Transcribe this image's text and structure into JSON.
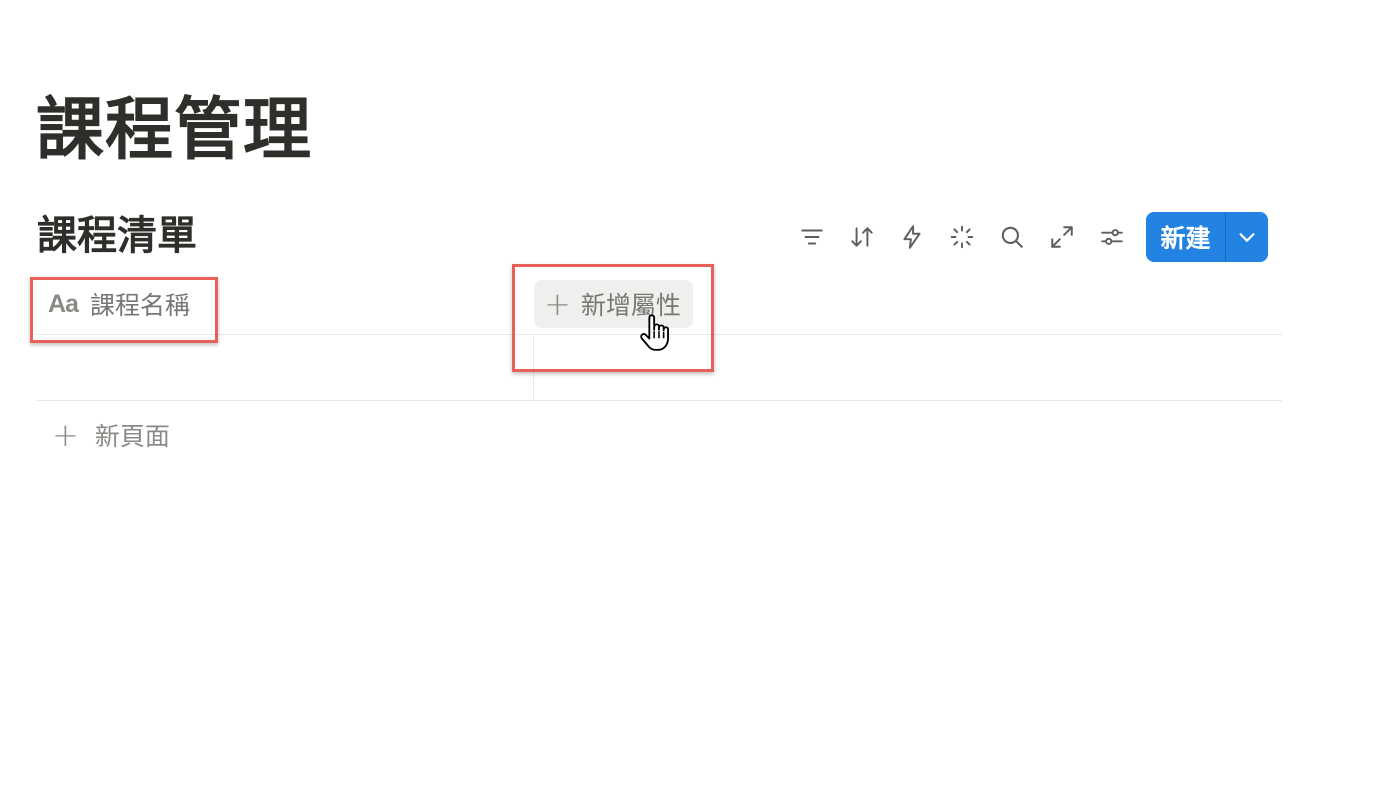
{
  "page": {
    "title": "課程管理"
  },
  "database": {
    "title": "課程清單",
    "toolbar": {
      "icons": [
        "filter-icon",
        "sort-icon",
        "automation-icon",
        "ai-sparkle-icon",
        "search-icon",
        "expand-icon",
        "settings-sliders-icon"
      ],
      "new_button_label": "新建"
    },
    "columns": {
      "name_icon": "Aa",
      "name_label": "課程名稱",
      "add_property_label": "新增屬性"
    },
    "new_page_label": "新頁面"
  },
  "colors": {
    "accent": "#2383e2",
    "highlight": "#e8605a",
    "muted_text": "#787774"
  }
}
